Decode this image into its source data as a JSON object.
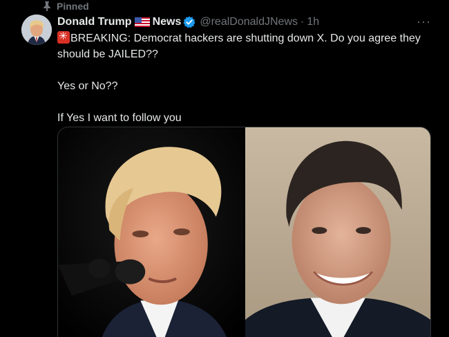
{
  "pinned": {
    "label": "Pinned",
    "icon": "pin-icon"
  },
  "author": {
    "name": "Donald Trump",
    "flag": "us-flag-icon",
    "name_suffix": "News",
    "verified": "verified-badge-icon",
    "handle": "@realDonaldJNews",
    "separator": "·",
    "time": "1h"
  },
  "tweet": {
    "line1": "BREAKING: Democrat hackers are shutting down X. Do you agree they should be JAILED??",
    "line2": "Yes or No??",
    "line3": "If Yes I want to follow you"
  },
  "media": {
    "photos": [
      {
        "subject": "man-with-microphone-photo"
      },
      {
        "subject": "smiling-man-photo"
      }
    ]
  },
  "colors": {
    "background": "#000000",
    "text": "#e7e9ea",
    "secondary": "#71767b",
    "verified_blue": "#1d9bf0",
    "siren_red": "#d93025"
  }
}
